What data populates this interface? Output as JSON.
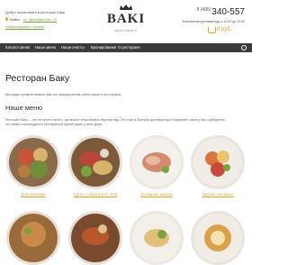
{
  "header": {
    "welcome": "Добро пожаловать в ресторан Баку",
    "city": "Бийск",
    "address": "ул. Декабристов, 22",
    "reserve": "Забронировать онлайн",
    "logo_text": "BAKI",
    "logo_sub": "RESTAURANT",
    "phone_code": "8 (495)",
    "phone": "340-557",
    "delivery_note": "Бесплатная доставка еды с 10:00 до 22:00",
    "cart_total": "0 руб."
  },
  "nav": {
    "items": [
      "Каталог меню",
      "Наше меню",
      "Наши ачетты",
      "Бронирование",
      "О ресторане"
    ]
  },
  "main": {
    "title": "Ресторан Баку",
    "intro": "Мы рады приветствовать Вас на официальном сайте нашего ресторана!",
    "menu_heading": "Наше меню",
    "description": "Ресторан Баку — это не просто место, где можно попробовать вкусную еду. Это ещё и быстрая доставка еды! Оформите заказ у нас и убедитесь что можно наслаждаться ресторанной кухней даже у себя дома."
  },
  "menu_cards": [
    {
      "label": "Для компании"
    },
    {
      "label": "Сеты с собой (на 4+ чел)"
    },
    {
      "label": "Холодные закуски"
    },
    {
      "label": "Закуски холодные"
    }
  ],
  "colors": {
    "accent": "#d9a52b",
    "nav_bg": "#3b3b3b",
    "link_green": "#7aa43b"
  }
}
